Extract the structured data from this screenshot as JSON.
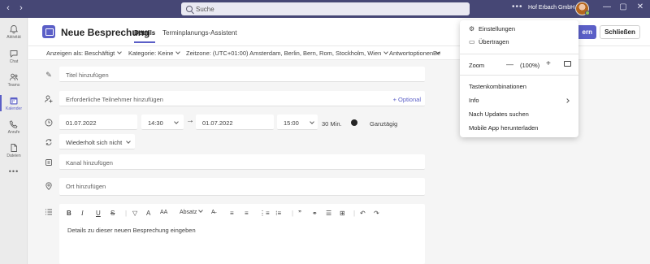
{
  "titlebar": {
    "back": "‹",
    "forward": "›",
    "search_placeholder": "Suche",
    "more": "•••",
    "org_name": "Hof Erbach GmbH",
    "minimize": "—",
    "restore": "▢",
    "close": "✕"
  },
  "rail": {
    "items": [
      {
        "label": "Aktivität",
        "icon": "bell-icon"
      },
      {
        "label": "Chat",
        "icon": "chat-icon"
      },
      {
        "label": "Teams",
        "icon": "teams-icon"
      },
      {
        "label": "Kalender",
        "icon": "calendar-icon"
      },
      {
        "label": "Anrufe",
        "icon": "phone-icon"
      },
      {
        "label": "Dateien",
        "icon": "file-icon"
      }
    ],
    "more": "•••"
  },
  "header": {
    "title": "Neue Besprechung",
    "tabs": [
      "Details",
      "Terminplanungs-Assistent"
    ],
    "save_label": "ern",
    "close_label": "Schließen"
  },
  "options": {
    "show_as": "Anzeigen als: Beschäftigt",
    "category": "Kategorie: Keine",
    "timezone": "Zeitzone: (UTC+01:00) Amsterdam, Berlin, Bern, Rom, Stockholm, Wien",
    "reply_options": "Antwortoptionen",
    "truncated": "Be"
  },
  "form": {
    "title_placeholder": "Titel hinzufügen",
    "attendees_placeholder": "Erforderliche Teilnehmer hinzufügen",
    "optional_label": "+ Optional",
    "start_date": "01.07.2022",
    "start_time": "14:30",
    "end_date": "01.07.2022",
    "end_time": "15:00",
    "duration": "30 Min.",
    "all_day": "Ganztägig",
    "repeat": "Wiederholt sich nicht",
    "channel_placeholder": "Kanal hinzufügen",
    "location_placeholder": "Ort hinzufügen"
  },
  "editor": {
    "paragraph_label": "Absatz",
    "placeholder": "Details zu dieser neuen Besprechung eingeben"
  },
  "menu": {
    "settings": "Einstellungen",
    "cast": "Übertragen",
    "zoom_label": "Zoom",
    "zoom_minus": "—",
    "zoom_value": "(100%)",
    "zoom_plus": "+",
    "shortcuts": "Tastenkombinationen",
    "info": "Info",
    "check_updates": "Nach Updates suchen",
    "mobile_app": "Mobile App herunterladen"
  },
  "colors": {
    "titlebar": "#464775",
    "accent": "#5b5fc7"
  }
}
